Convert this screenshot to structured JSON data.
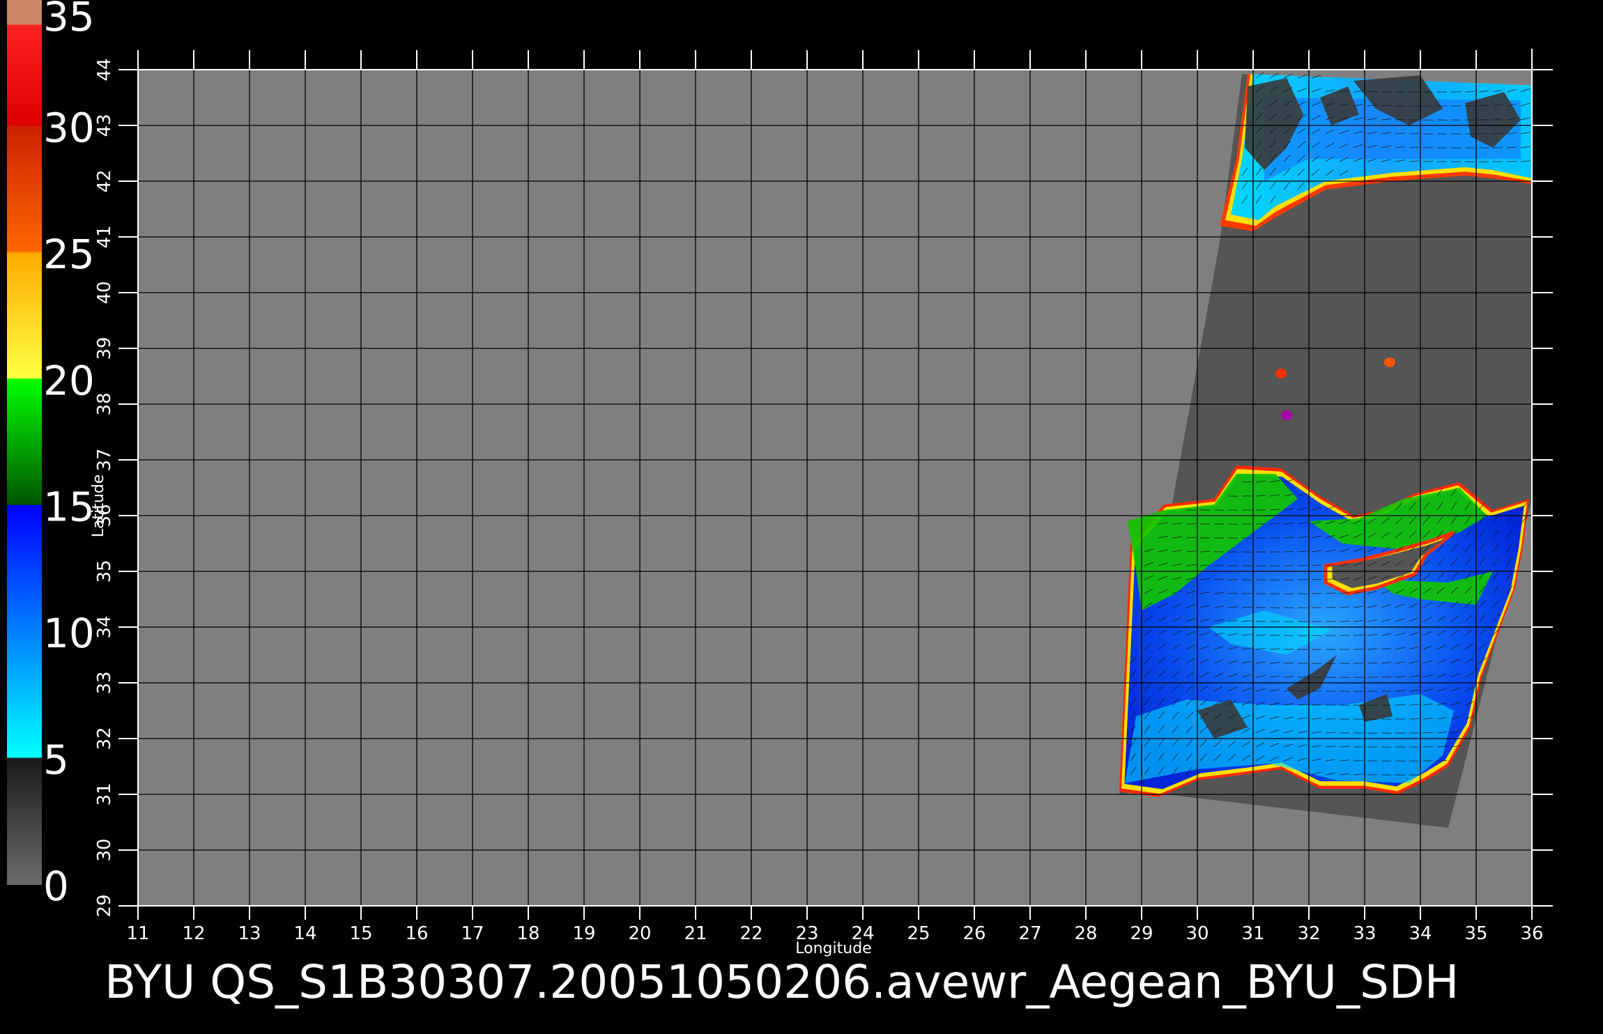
{
  "chart_data": {
    "type": "heatmap",
    "title": "BYU  QS_S1B30307.20051050206.avewr_Aegean_BYU_SDH",
    "xlabel": "Longitude",
    "ylabel": "Latitude",
    "xlim": [
      11,
      36
    ],
    "ylim": [
      29,
      44
    ],
    "x_ticks": [
      "11",
      "12",
      "13",
      "14",
      "15",
      "16",
      "17",
      "18",
      "19",
      "20",
      "21",
      "22",
      "23",
      "24",
      "25",
      "26",
      "27",
      "28",
      "29",
      "30",
      "31",
      "32",
      "33",
      "34",
      "35",
      "36"
    ],
    "y_ticks": [
      "29",
      "30",
      "31",
      "32",
      "33",
      "34",
      "35",
      "36",
      "37",
      "38",
      "39",
      "40",
      "41",
      "42",
      "43",
      "44"
    ],
    "grid": true,
    "colorbar": {
      "ticks": [
        "0",
        "5",
        "10",
        "15",
        "20",
        "25",
        "30",
        "35"
      ],
      "range": [
        0,
        35
      ],
      "stops": [
        {
          "value": 0,
          "color": "#6b6b6b"
        },
        {
          "value": 5,
          "color": "#1a1a1a"
        },
        {
          "value": 5.05,
          "color": "#00ffff"
        },
        {
          "value": 15,
          "color": "#0000ff"
        },
        {
          "value": 15.05,
          "color": "#005500"
        },
        {
          "value": 20,
          "color": "#00ff00"
        },
        {
          "value": 20.05,
          "color": "#ffff44"
        },
        {
          "value": 25,
          "color": "#ffaa00"
        },
        {
          "value": 25.05,
          "color": "#ff6600"
        },
        {
          "value": 30,
          "color": "#cc2200"
        },
        {
          "value": 30.05,
          "color": "#dd0000"
        },
        {
          "value": 34,
          "color": "#ff2222"
        },
        {
          "value": 34.05,
          "color": "#cc8866"
        },
        {
          "value": 35,
          "color": "#cc8866"
        }
      ]
    },
    "colors": {
      "background": "#000000",
      "plot_fill": "#7f7f7f",
      "swath_fill": "#555555",
      "grid": "#000000",
      "axis": "#ffffff",
      "low_wind": "#00ffff",
      "mid_wind": "#0033ff",
      "high_wind": "#00cc00",
      "coast": "#ff3300"
    }
  }
}
